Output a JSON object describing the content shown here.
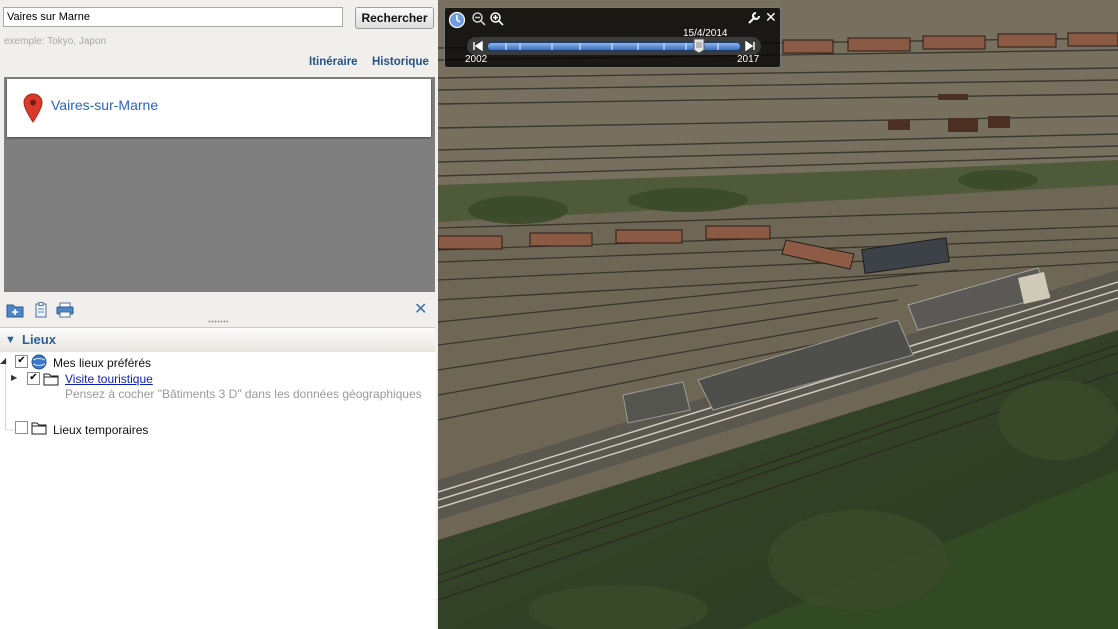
{
  "search": {
    "value": "Vaires sur Marne",
    "button_label": "Rechercher",
    "hint": "exemple: Tokyo, Japon"
  },
  "links": {
    "itineraire": "Itinéraire",
    "historique": "Historique"
  },
  "result": {
    "title": "Vaires-sur-Marne",
    "pin_color": "#d93a2b"
  },
  "toolbar": {
    "icons": [
      "folder-add-icon",
      "clipboard-icon",
      "print-icon"
    ],
    "close": "✕"
  },
  "places": {
    "header": "Lieux",
    "items": [
      {
        "label": "Mes lieux préférés",
        "checked": true,
        "icon": "globe-icon"
      },
      {
        "label": "Visite touristique",
        "checked": true,
        "icon": "folder-icon",
        "description": "Pensez à cocher \"Bâtiments 3 D\" dans les données géographiques"
      },
      {
        "label": "Lieux temporaires",
        "checked": false,
        "icon": "folder-icon"
      }
    ]
  },
  "timeline": {
    "date": "15/4/2014",
    "start_year": "2002",
    "end_year": "2017",
    "position": 0.84
  },
  "colors": {
    "accent": "#2b5e9e",
    "link": "#24528a"
  }
}
